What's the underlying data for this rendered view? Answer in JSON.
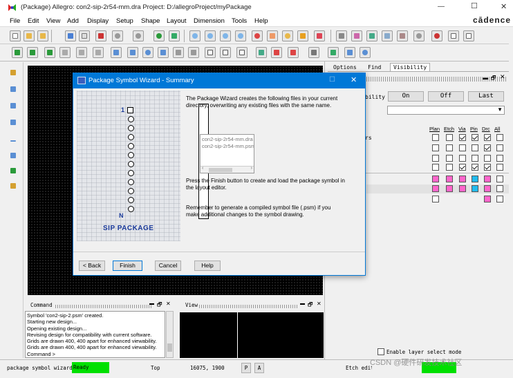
{
  "window": {
    "title": "(Package) Allegro: con2-sip-2r54-mm.dra  Project: D:/allegroProject/myPackage",
    "brand": "cādence",
    "controls": {
      "minimize": "—",
      "maximize": "☐",
      "close": "✕"
    }
  },
  "menu": [
    "File",
    "Edit",
    "View",
    "Add",
    "Display",
    "Setup",
    "Shape",
    "Layout",
    "Dimension",
    "Tools",
    "Help"
  ],
  "panel_tabs": [
    "Options",
    "Find",
    "Visibility"
  ],
  "visibility": {
    "label_fragment": "bility",
    "buttons": [
      "On",
      "Off",
      "Last"
    ],
    "columns": [
      "Plan",
      "Etch",
      "Via",
      "Pin",
      "Drc",
      "All"
    ],
    "row_fragment": "rs",
    "enable_layer_select": "Enable layer select mode",
    "grid": [
      [
        false,
        false,
        true,
        true,
        true,
        false
      ],
      [
        false,
        false,
        false,
        false,
        true,
        false
      ],
      [
        false,
        false,
        false,
        false,
        false,
        false
      ],
      [
        false,
        false,
        true,
        true,
        true,
        false
      ]
    ],
    "swatch_rows": [
      [
        "#ff66cc",
        "#ff66cc",
        "#ff66cc",
        "#22bbee",
        "#ff66cc",
        "white"
      ],
      [
        "#ff66cc",
        "#ff66cc",
        "#ff66cc",
        "#22bbee",
        "#ff66cc",
        "white"
      ],
      [
        "white",
        "",
        "",
        "",
        "#ff66cc",
        "white"
      ]
    ]
  },
  "dialog": {
    "title": "Package Symbol Wizard - Summary",
    "text1": "The Package Wizard creates the following files in your current directory, overwriting any existing files with the same name.",
    "files": [
      "con2-sip-2r54-mm.dra",
      "con2-sip-2r54-mm.psm"
    ],
    "text2": "Press the Finish button to create and load the package symbol in the layout editor.",
    "text3": "Remember to generate a compiled symbol file (.psm) if you make additional changes to the symbol drawing.",
    "package_label": "SIP PACKAGE",
    "pin_first": "1",
    "pin_last": "N",
    "buttons": {
      "back": "< Back",
      "finish": "Finish",
      "cancel": "Cancel",
      "help": "Help"
    }
  },
  "command_panel": {
    "title": "Command",
    "lines": [
      "Symbol 'con2-sip-2.psm' created.",
      "Starting new design...",
      "Opening existing design...",
      "Revising design for compatibility with current software.",
      "Grids are drawn 400, 400 apart for enhanced viewability.",
      "Grids are drawn 400, 400 apart for enhanced viewability.",
      "Command >"
    ]
  },
  "view_panel": {
    "title": "View"
  },
  "status": {
    "command": "package symbol wizard",
    "state": "Ready",
    "layer": "Top",
    "coords": "16075, 1900",
    "p_btn": "P",
    "a_btn": "A",
    "etch": "Etch edit",
    "watermark": "CSDN @硬件研发技术社区"
  },
  "colors": {
    "accent": "#0078d7",
    "ready": "#00e000",
    "pink": "#ff66cc",
    "cyan": "#22bbee"
  }
}
